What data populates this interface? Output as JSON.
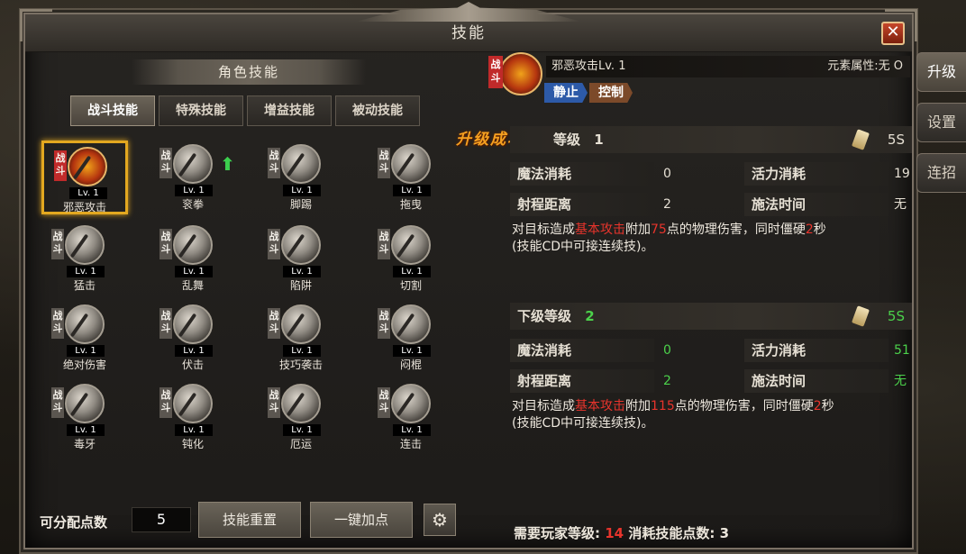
{
  "window": {
    "title": "技能",
    "close_icon": "close-icon"
  },
  "side_tabs": [
    {
      "label": "升级",
      "active": true
    },
    {
      "label": "设置",
      "active": false
    },
    {
      "label": "连招",
      "active": false
    }
  ],
  "left": {
    "section_title": "角色技能",
    "tabs": [
      {
        "label": "战斗技能",
        "active": true
      },
      {
        "label": "特殊技能",
        "active": false
      },
      {
        "label": "增益技能",
        "active": false
      },
      {
        "label": "被动技能",
        "active": false
      }
    ],
    "skill_tag": "战斗",
    "skills": [
      {
        "level": "Lv. 1",
        "name": "邪恶攻击",
        "selected": true,
        "upgradeable": false
      },
      {
        "level": "Lv. 1",
        "name": "衮拳",
        "selected": false,
        "upgradeable": true
      },
      {
        "level": "Lv. 1",
        "name": "脚踢",
        "selected": false,
        "upgradeable": false
      },
      {
        "level": "Lv. 1",
        "name": "拖曳",
        "selected": false,
        "upgradeable": false
      },
      {
        "level": "Lv. 1",
        "name": "猛击",
        "selected": false,
        "upgradeable": false
      },
      {
        "level": "Lv. 1",
        "name": "乱舞",
        "selected": false,
        "upgradeable": false
      },
      {
        "level": "Lv. 1",
        "name": "陷阱",
        "selected": false,
        "upgradeable": false
      },
      {
        "level": "Lv. 1",
        "name": "切割",
        "selected": false,
        "upgradeable": false
      },
      {
        "level": "Lv. 1",
        "name": "绝对伤害",
        "selected": false,
        "upgradeable": false
      },
      {
        "level": "Lv. 1",
        "name": "伏击",
        "selected": false,
        "upgradeable": false
      },
      {
        "level": "Lv. 1",
        "name": "技巧袭击",
        "selected": false,
        "upgradeable": false
      },
      {
        "level": "Lv. 1",
        "name": "闷棍",
        "selected": false,
        "upgradeable": false
      },
      {
        "level": "Lv. 1",
        "name": "毒牙",
        "selected": false,
        "upgradeable": false
      },
      {
        "level": "Lv. 1",
        "name": "钝化",
        "selected": false,
        "upgradeable": false
      },
      {
        "level": "Lv. 1",
        "name": "厄运",
        "selected": false,
        "upgradeable": false
      },
      {
        "level": "Lv. 1",
        "name": "连击",
        "selected": false,
        "upgradeable": false
      }
    ],
    "points_label": "可分配点数",
    "points_value": "5",
    "reset_button": "技能重置",
    "one_click_button": "一键加点",
    "gear_icon": "gear-icon"
  },
  "detail": {
    "skill_tag": "战斗",
    "skill_name": "邪恶攻击Lv. 1",
    "element_label": "元素属性:无",
    "element_symbol": "O",
    "state_tags": [
      "静止",
      "控制"
    ],
    "success_badge": "升级成功",
    "current": {
      "level_label": "等级",
      "level_value": "1",
      "cooldown": "5S",
      "mana_label": "魔法消耗",
      "mana_value": "0",
      "vigor_label": "活力消耗",
      "vigor_value": "19",
      "range_label": "射程距离",
      "range_value": "2",
      "cast_label": "施法时间",
      "cast_value": "无",
      "desc_1": "对目标造成",
      "desc_hl1": "基本攻击",
      "desc_2": "附加",
      "desc_hl2": "75",
      "desc_3": "点的物理伤害，同时僵硬",
      "desc_hl3": "2",
      "desc_4": "秒",
      "desc_line2": "(技能CD中可接连续技)。"
    },
    "next": {
      "level_label": "下级等级",
      "level_value": "2",
      "cooldown": "5S",
      "mana_label": "魔法消耗",
      "mana_value": "0",
      "vigor_label": "活力消耗",
      "vigor_value": "51",
      "range_label": "射程距离",
      "range_value": "2",
      "cast_label": "施法时间",
      "cast_value": "无",
      "desc_1": "对目标造成",
      "desc_hl1": "基本攻击",
      "desc_2": "附加",
      "desc_hl2": "115",
      "desc_3": "点的物理伤害，同时僵硬",
      "desc_hl3": "2",
      "desc_4": "秒",
      "desc_line2": "(技能CD中可接连续技)。"
    },
    "footer": {
      "req_label": "需要玩家等级:",
      "req_value": "14",
      "cost_label": "消耗技能点数:",
      "cost_value": "3"
    }
  },
  "colors": {
    "highlight_red": "#e8342c",
    "highlight_green": "#4bd14b",
    "selected_border": "#e3a820"
  }
}
